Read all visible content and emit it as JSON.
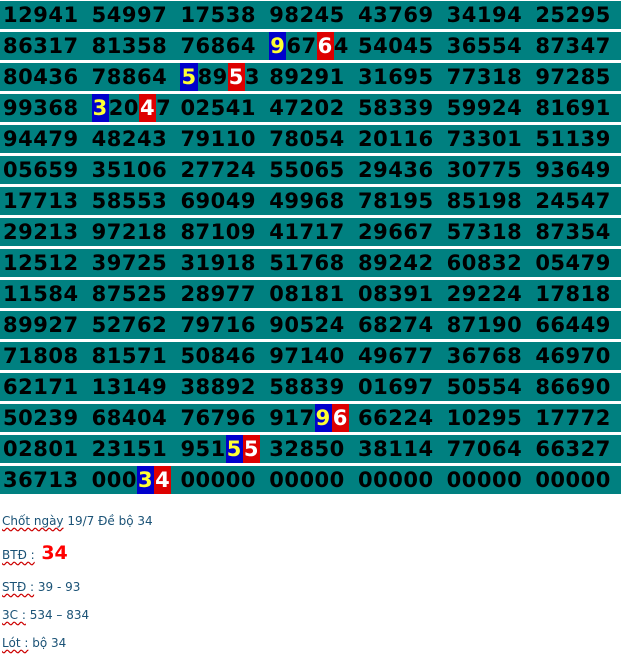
{
  "colors": {
    "cell_bg": "#008080",
    "hl_blue": "#0000cc",
    "hl_red": "#dd0000",
    "note_text": "#1a5276",
    "accent_red": "#ff0000"
  },
  "rows": [
    [
      [
        {
          "t": "12941"
        }
      ],
      [
        {
          "t": "54997"
        }
      ],
      [
        {
          "t": "17538"
        }
      ],
      [
        {
          "t": "98245"
        }
      ],
      [
        {
          "t": "43769"
        }
      ],
      [
        {
          "t": "34194"
        }
      ],
      [
        {
          "t": "25295"
        }
      ]
    ],
    [
      [
        {
          "t": "86317"
        }
      ],
      [
        {
          "t": "81358"
        }
      ],
      [
        {
          "t": "76864"
        }
      ],
      [
        {
          "t": "9",
          "c": "blue"
        },
        {
          "t": "67"
        },
        {
          "t": "6",
          "c": "red"
        },
        {
          "t": "4"
        }
      ],
      [
        {
          "t": "54045"
        }
      ],
      [
        {
          "t": "36554"
        }
      ],
      [
        {
          "t": "87347"
        }
      ]
    ],
    [
      [
        {
          "t": "80436"
        }
      ],
      [
        {
          "t": "78864"
        }
      ],
      [
        {
          "t": "5",
          "c": "blue"
        },
        {
          "t": "89"
        },
        {
          "t": "5",
          "c": "red"
        },
        {
          "t": "3"
        }
      ],
      [
        {
          "t": "89291"
        }
      ],
      [
        {
          "t": "31695"
        }
      ],
      [
        {
          "t": "77318"
        }
      ],
      [
        {
          "t": "97285"
        }
      ]
    ],
    [
      [
        {
          "t": "99368"
        }
      ],
      [
        {
          "t": "3",
          "c": "blue"
        },
        {
          "t": "20"
        },
        {
          "t": "4",
          "c": "red"
        },
        {
          "t": "7"
        }
      ],
      [
        {
          "t": "02541"
        }
      ],
      [
        {
          "t": "47202"
        }
      ],
      [
        {
          "t": "58339"
        }
      ],
      [
        {
          "t": "59924"
        }
      ],
      [
        {
          "t": "81691"
        }
      ]
    ],
    [
      [
        {
          "t": "94479"
        }
      ],
      [
        {
          "t": "48243"
        }
      ],
      [
        {
          "t": "79110"
        }
      ],
      [
        {
          "t": "78054"
        }
      ],
      [
        {
          "t": "20116"
        }
      ],
      [
        {
          "t": "73301"
        }
      ],
      [
        {
          "t": "51139"
        }
      ]
    ],
    [
      [
        {
          "t": "05659"
        }
      ],
      [
        {
          "t": "35106"
        }
      ],
      [
        {
          "t": "27724"
        }
      ],
      [
        {
          "t": "55065"
        }
      ],
      [
        {
          "t": "29436"
        }
      ],
      [
        {
          "t": "30775"
        }
      ],
      [
        {
          "t": "93649"
        }
      ]
    ],
    [
      [
        {
          "t": "17713"
        }
      ],
      [
        {
          "t": "58553"
        }
      ],
      [
        {
          "t": "69049"
        }
      ],
      [
        {
          "t": "49968"
        }
      ],
      [
        {
          "t": "78195"
        }
      ],
      [
        {
          "t": "85198"
        }
      ],
      [
        {
          "t": "24547"
        }
      ]
    ],
    [
      [
        {
          "t": "29213"
        }
      ],
      [
        {
          "t": "97218"
        }
      ],
      [
        {
          "t": "87109"
        }
      ],
      [
        {
          "t": "41717"
        }
      ],
      [
        {
          "t": "29667"
        }
      ],
      [
        {
          "t": "57318"
        }
      ],
      [
        {
          "t": "87354"
        }
      ]
    ],
    [
      [
        {
          "t": "12512"
        }
      ],
      [
        {
          "t": "39725"
        }
      ],
      [
        {
          "t": "31918"
        }
      ],
      [
        {
          "t": "51768"
        }
      ],
      [
        {
          "t": "89242"
        }
      ],
      [
        {
          "t": "60832"
        }
      ],
      [
        {
          "t": "05479"
        }
      ]
    ],
    [
      [
        {
          "t": "11584"
        }
      ],
      [
        {
          "t": "87525"
        }
      ],
      [
        {
          "t": "28977"
        }
      ],
      [
        {
          "t": "08181"
        }
      ],
      [
        {
          "t": "08391"
        }
      ],
      [
        {
          "t": "29224"
        }
      ],
      [
        {
          "t": "17818"
        }
      ]
    ],
    [
      [
        {
          "t": "89927"
        }
      ],
      [
        {
          "t": "52762"
        }
      ],
      [
        {
          "t": "79716"
        }
      ],
      [
        {
          "t": "90524"
        }
      ],
      [
        {
          "t": "68274"
        }
      ],
      [
        {
          "t": "87190"
        }
      ],
      [
        {
          "t": "66449"
        }
      ]
    ],
    [
      [
        {
          "t": "71808"
        }
      ],
      [
        {
          "t": "81571"
        }
      ],
      [
        {
          "t": "50846"
        }
      ],
      [
        {
          "t": "97140"
        }
      ],
      [
        {
          "t": "49677"
        }
      ],
      [
        {
          "t": "36768"
        }
      ],
      [
        {
          "t": "46970"
        }
      ]
    ],
    [
      [
        {
          "t": "62171"
        }
      ],
      [
        {
          "t": "13149"
        }
      ],
      [
        {
          "t": "38892"
        }
      ],
      [
        {
          "t": "58839"
        }
      ],
      [
        {
          "t": "01697"
        }
      ],
      [
        {
          "t": "50554"
        }
      ],
      [
        {
          "t": "86690"
        }
      ]
    ],
    [
      [
        {
          "t": "50239"
        }
      ],
      [
        {
          "t": "68404"
        }
      ],
      [
        {
          "t": "76796"
        }
      ],
      [
        {
          "t": "917"
        },
        {
          "t": "9",
          "c": "blue"
        },
        {
          "t": "6",
          "c": "red"
        }
      ],
      [
        {
          "t": "66224"
        }
      ],
      [
        {
          "t": "10295"
        }
      ],
      [
        {
          "t": "17772"
        }
      ]
    ],
    [
      [
        {
          "t": "02801"
        }
      ],
      [
        {
          "t": "23151"
        }
      ],
      [
        {
          "t": "951"
        },
        {
          "t": "5",
          "c": "blue"
        },
        {
          "t": "5",
          "c": "red"
        }
      ],
      [
        {
          "t": "32850"
        }
      ],
      [
        {
          "t": "38114"
        }
      ],
      [
        {
          "t": "77064"
        }
      ],
      [
        {
          "t": "66327"
        }
      ]
    ],
    [
      [
        {
          "t": "36713"
        }
      ],
      [
        {
          "t": "000"
        },
        {
          "t": "3",
          "c": "blue"
        },
        {
          "t": "4",
          "c": "red"
        }
      ],
      [
        {
          "t": "00000"
        }
      ],
      [
        {
          "t": "00000"
        }
      ],
      [
        {
          "t": "00000"
        }
      ],
      [
        {
          "t": "00000"
        }
      ],
      [
        {
          "t": "00000"
        }
      ]
    ]
  ],
  "notes": {
    "chot_label": "Chốt ngày",
    "chot_text": " 19/7 Đề bộ 34",
    "btd_label": "BTĐ :",
    "btd_value": " 34",
    "std_label": "STĐ :",
    "std_value": " 39 - 93",
    "three_c_label": "3C :",
    "three_c_value": " 534  – 834",
    "lot_label": "Lót :",
    "lot_value": "  bộ 34"
  }
}
